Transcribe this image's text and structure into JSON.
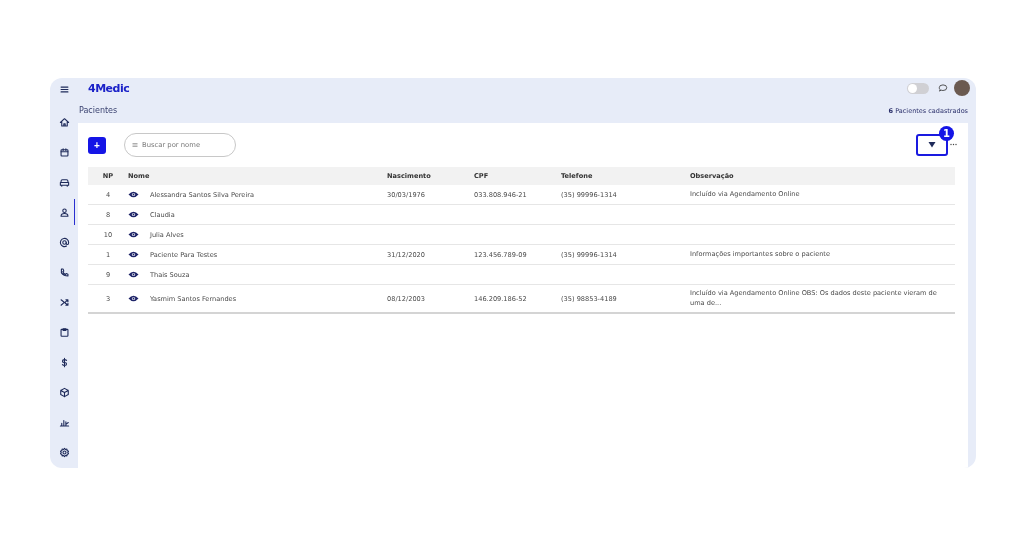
{
  "brand": {
    "logo": "4Medic"
  },
  "sidebar": {
    "items": [
      {
        "kind": "home",
        "selected": false
      },
      {
        "kind": "calendar",
        "selected": false
      },
      {
        "kind": "sofa",
        "selected": false
      },
      {
        "kind": "user",
        "selected": true
      },
      {
        "kind": "at",
        "selected": false
      },
      {
        "kind": "phone",
        "selected": false
      },
      {
        "kind": "shuffle",
        "selected": false
      },
      {
        "kind": "clipboard",
        "selected": false
      },
      {
        "kind": "dollar",
        "selected": false
      },
      {
        "kind": "cube",
        "selected": false
      },
      {
        "kind": "chart",
        "selected": false
      },
      {
        "kind": "gear",
        "selected": false
      }
    ]
  },
  "topbar": {
    "theme_toggle": {
      "on": false
    }
  },
  "page": {
    "title": "Pacientes",
    "count": "6",
    "count_label": "Pacientes cadastrados"
  },
  "toolbar": {
    "add_button": "+",
    "search": {
      "placeholder": "Buscar por nome"
    },
    "filter_badge": "1"
  },
  "table": {
    "columns": [
      "NP",
      "Nome",
      "Nascimento",
      "CPF",
      "Telefone",
      "Observação"
    ],
    "rows": [
      {
        "np": "4",
        "name": "Alessandra Santos Silva Pereira",
        "birth": "30/03/1976",
        "cpf": "033.808.946-21",
        "phone": "(35) 99996-1314",
        "note": "Incluído via Agendamento Online"
      },
      {
        "np": "8",
        "name": "Claudia",
        "birth": "",
        "cpf": "",
        "phone": "",
        "note": ""
      },
      {
        "np": "10",
        "name": "Julia Alves",
        "birth": "",
        "cpf": "",
        "phone": "",
        "note": ""
      },
      {
        "np": "1",
        "name": "Paciente Para Testes",
        "birth": "31/12/2020",
        "cpf": "123.456.789-09",
        "phone": "(35) 99996-1314",
        "note": "Informações importantes sobre o paciente"
      },
      {
        "np": "9",
        "name": "Thais Souza",
        "birth": "",
        "cpf": "",
        "phone": "",
        "note": ""
      },
      {
        "np": "3",
        "name": "Yasmim Santos Fernandes",
        "birth": "08/12/2003",
        "cpf": "146.209.186-52",
        "phone": "(35) 98853-4189",
        "note": "Incluído via Agendamento Online OBS: Os dados deste paciente vieram de uma de..."
      }
    ]
  }
}
